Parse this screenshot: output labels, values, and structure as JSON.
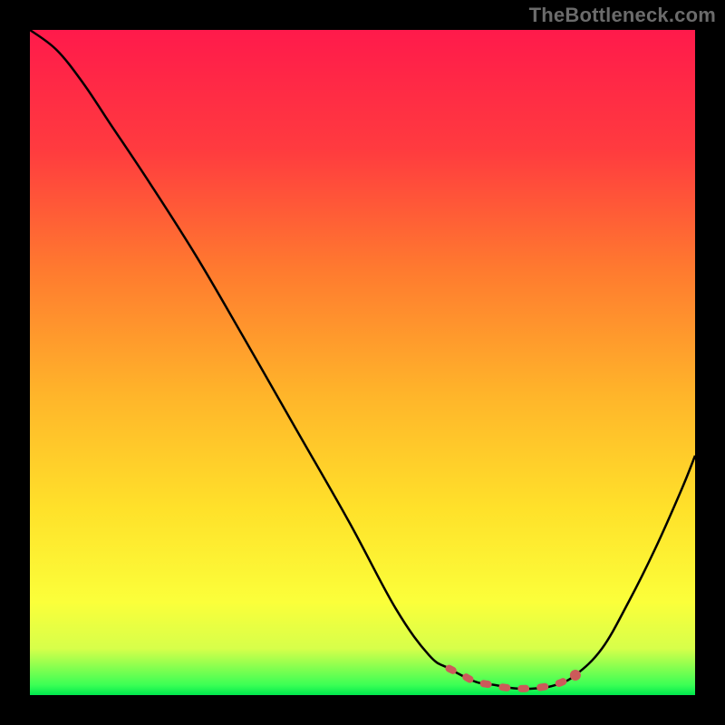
{
  "watermark": "TheBottleneck.com",
  "chart_data": {
    "type": "line",
    "title": "",
    "xlabel": "",
    "ylabel": "",
    "xlim": [
      0,
      100
    ],
    "ylim": [
      0,
      100
    ],
    "grid": false,
    "legend": false,
    "annotations": [],
    "gradient_stops": [
      {
        "offset": 0.0,
        "color": "#ff1a4b"
      },
      {
        "offset": 0.18,
        "color": "#ff3b3f"
      },
      {
        "offset": 0.36,
        "color": "#ff7a2f"
      },
      {
        "offset": 0.55,
        "color": "#ffb52a"
      },
      {
        "offset": 0.72,
        "color": "#ffe12a"
      },
      {
        "offset": 0.86,
        "color": "#fbff3a"
      },
      {
        "offset": 0.93,
        "color": "#d7ff4a"
      },
      {
        "offset": 0.985,
        "color": "#3bff55"
      },
      {
        "offset": 1.0,
        "color": "#00e84e"
      }
    ],
    "series": [
      {
        "name": "bottleneck-curve",
        "color": "#000000",
        "x": [
          0,
          4,
          8,
          12,
          18,
          25,
          32,
          40,
          48,
          55,
          60,
          63,
          67,
          70,
          73,
          76,
          79,
          82,
          86,
          90,
          94,
          98,
          100
        ],
        "y": [
          100,
          97,
          92,
          86,
          77,
          66,
          54,
          40,
          26,
          13,
          6,
          4,
          2,
          1.5,
          1,
          1,
          1.5,
          3,
          7,
          14,
          22,
          31,
          36
        ]
      },
      {
        "name": "optimal-marker",
        "color": "#cc5a5a",
        "style": "dashed-thick",
        "x": [
          63,
          65,
          67,
          69,
          71,
          73,
          75,
          77,
          79,
          81,
          82
        ],
        "y": [
          4,
          3,
          2,
          1.6,
          1.2,
          1,
          1,
          1.2,
          1.6,
          2.4,
          3
        ]
      }
    ]
  }
}
